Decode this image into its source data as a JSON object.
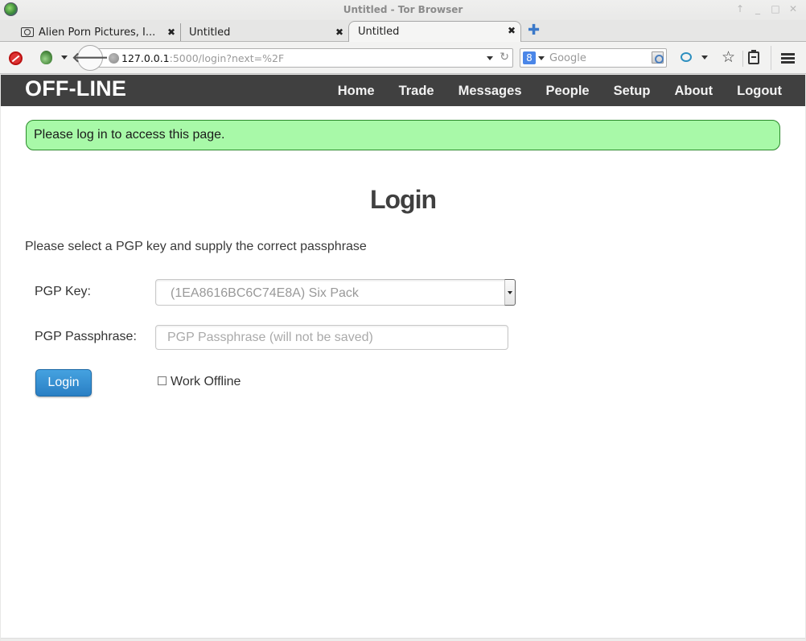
{
  "window": {
    "title": "Untitled - Tor Browser",
    "controls": [
      "↑",
      "_",
      "□",
      "✕"
    ]
  },
  "tabs": [
    {
      "label": "Alien Porn Pictures, I...",
      "icon": "camera-icon",
      "active": false
    },
    {
      "label": "Untitled",
      "active": false
    },
    {
      "label": "Untitled",
      "active": true
    }
  ],
  "toolbar": {
    "url_host": "127.0.0.1",
    "url_rest": ":5000/login?next=%2F",
    "search_placeholder": "Google",
    "search_engine_glyph": "8",
    "back_glyph": "🡐",
    "reload_glyph": "↻",
    "star_glyph": "☆",
    "close_glyph": "✖",
    "newtab_glyph": "✚"
  },
  "site": {
    "brand": "OFF-LINE",
    "nav": [
      "Home",
      "Trade",
      "Messages",
      "People",
      "Setup",
      "About",
      "Logout"
    ],
    "flash": "Please log in to access this page.",
    "flash_color": "#a8f9a8"
  },
  "login": {
    "title": "Login",
    "intro": "Please select a PGP key and supply the correct passphrase",
    "key_label": "PGP Key:",
    "key_selected": "(1EA8616BC6C74E8A)   Six Pack",
    "pass_label": "PGP Passphrase:",
    "pass_placeholder": "PGP Passphrase (will not be saved)",
    "pass_value": "",
    "button": "Login",
    "button_color": "#2a7fc4",
    "offline_label": "Work Offline",
    "offline_checked": false
  }
}
